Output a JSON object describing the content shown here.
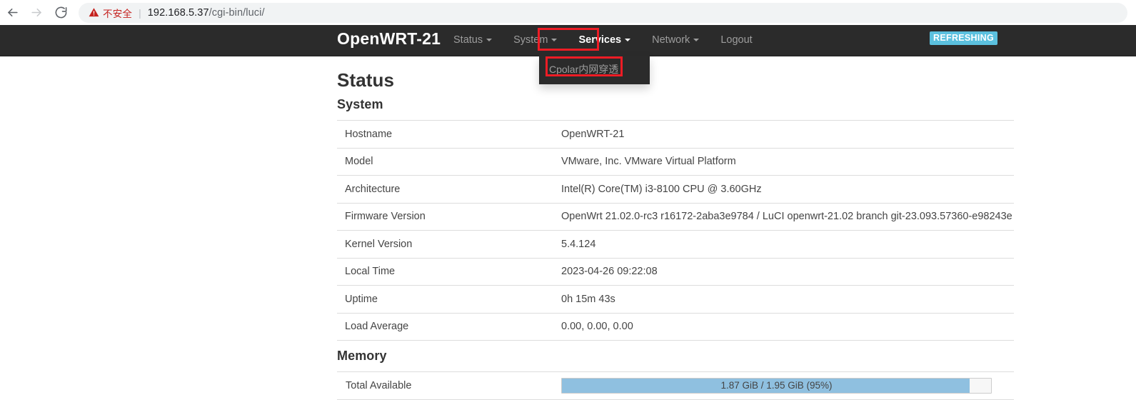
{
  "browser": {
    "back_icon": "back-arrow-icon",
    "forward_icon": "forward-arrow-icon",
    "reload_icon": "reload-icon",
    "security_icon": "warning-triangle-icon",
    "security_label": "不安全",
    "separator": "|",
    "url_host": "192.168.5.37",
    "url_path": "/cgi-bin/luci/",
    "url_full": "192.168.5.37/cgi-bin/luci/"
  },
  "navbar": {
    "brand": "OpenWRT-21",
    "items": [
      {
        "label": "Status",
        "has_caret": true,
        "active": false
      },
      {
        "label": "System",
        "has_caret": true,
        "active": false
      },
      {
        "label": "Services",
        "has_caret": true,
        "active": true
      },
      {
        "label": "Network",
        "has_caret": true,
        "active": false
      },
      {
        "label": "Logout",
        "has_caret": false,
        "active": false
      }
    ],
    "dropdown": {
      "items": [
        {
          "label": "Cpolar内网穿透"
        }
      ]
    },
    "status_badge": "REFRESHING",
    "badge_color": "#5bc0de",
    "highlight_color": "#ee1c25"
  },
  "page": {
    "title": "Status",
    "sections": [
      {
        "title": "System",
        "rows": [
          {
            "label": "Hostname",
            "value": "OpenWRT-21"
          },
          {
            "label": "Model",
            "value": "VMware, Inc. VMware Virtual Platform"
          },
          {
            "label": "Architecture",
            "value": "Intel(R) Core(TM) i3-8100 CPU @ 3.60GHz"
          },
          {
            "label": "Firmware Version",
            "value": "OpenWrt 21.02.0-rc3 r16172-2aba3e9784 / LuCI openwrt-21.02 branch git-23.093.57360-e98243e"
          },
          {
            "label": "Kernel Version",
            "value": "5.4.124"
          },
          {
            "label": "Local Time",
            "value": "2023-04-26 09:22:08"
          },
          {
            "label": "Uptime",
            "value": "0h 15m 43s"
          },
          {
            "label": "Load Average",
            "value": "0.00, 0.00, 0.00"
          }
        ]
      },
      {
        "title": "Memory",
        "bar_rows": [
          {
            "label": "Total Available",
            "text": "1.87 GiB / 1.95 GiB (95%)",
            "percent": 95,
            "fill_color": "#8fc0e0"
          }
        ]
      }
    ]
  }
}
